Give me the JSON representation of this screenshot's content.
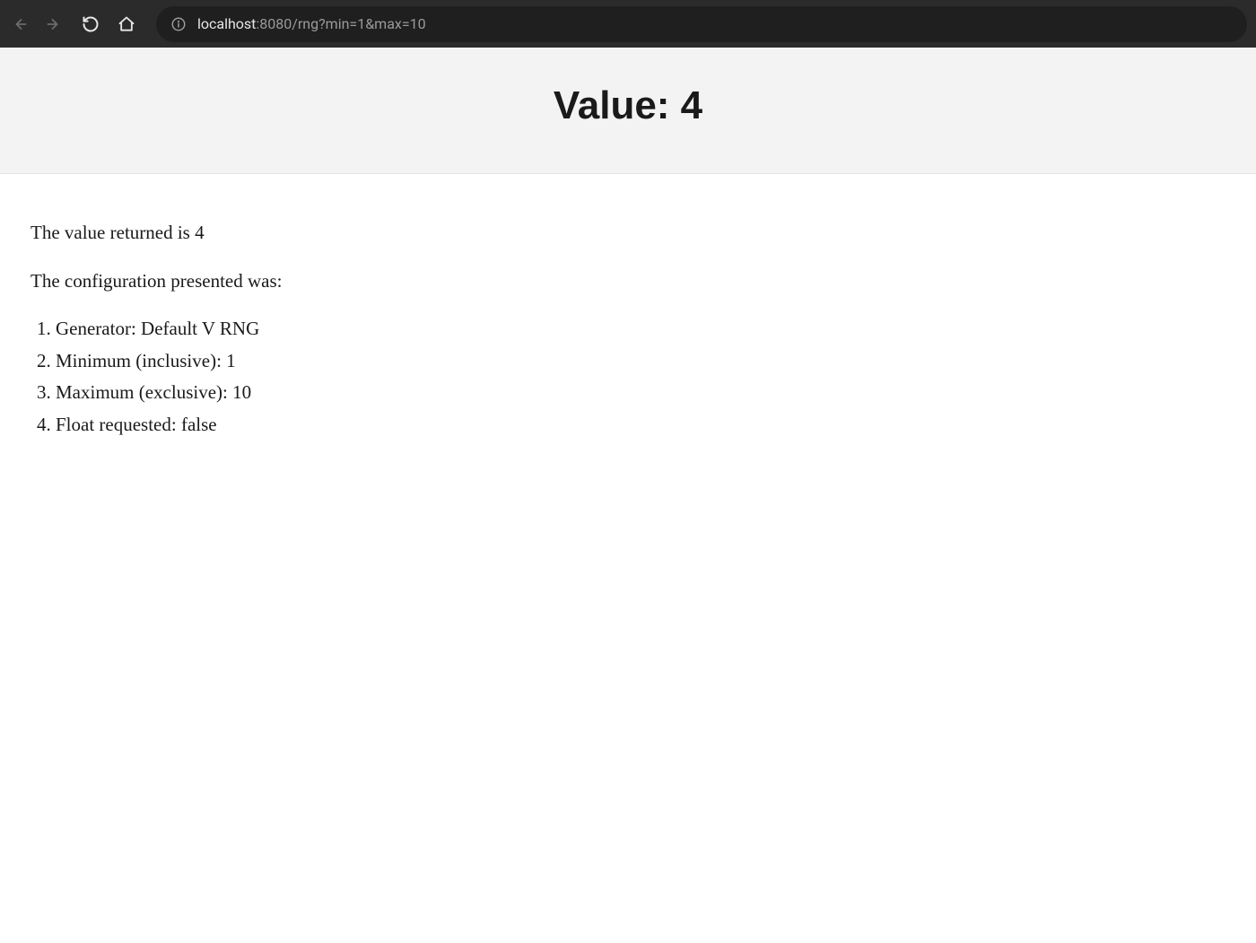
{
  "browser": {
    "url_host": "localhost",
    "url_port_path": ":8080/rng?min=1&max=10"
  },
  "page": {
    "title": "Value: 4",
    "summary": "The value returned is 4",
    "config_intro": "The configuration presented was:",
    "config_items": [
      "Generator: Default V RNG",
      "Minimum (inclusive): 1",
      "Maximum (exclusive): 10",
      "Float requested: false"
    ]
  }
}
